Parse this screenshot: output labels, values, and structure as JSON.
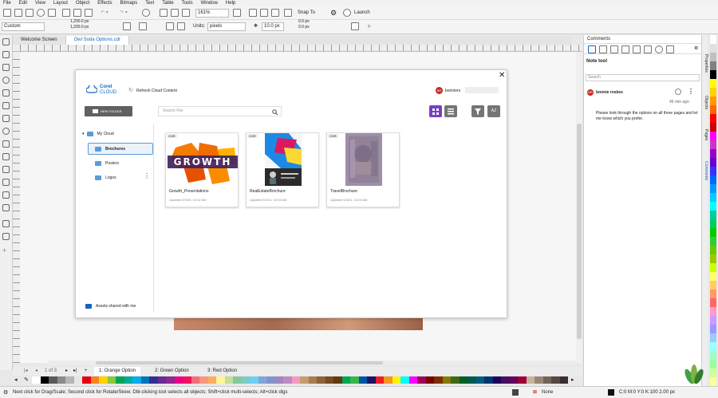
{
  "menu": [
    "File",
    "Edit",
    "View",
    "Layout",
    "Object",
    "Effects",
    "Bitmaps",
    "Text",
    "Table",
    "Tools",
    "Window",
    "Help"
  ],
  "toolbar": {
    "zoom": "161%",
    "snap_label": "Snap To",
    "launch_label": "Launch",
    "preset": "Custom",
    "width": "1,200.0 px",
    "height": "1,200.0 px",
    "units_label": "Units:",
    "units": "pixels",
    "nudge": "10.0 px",
    "dup_x": "0.0 px",
    "dup_y": "0.0 px"
  },
  "doc_tabs": [
    {
      "label": "Welcome Screen"
    },
    {
      "label": "Owl Soda Options.cdr"
    }
  ],
  "dialog": {
    "logo_line1": "Corel",
    "logo_line2": "CLOUD",
    "refresh_label": "Refresh Cloud Content",
    "user_initials": "BR",
    "user_name": "bonniers",
    "new_folder_label": "NEW FOLDER",
    "search_placeholder": "Search File",
    "tree": {
      "root": "My Cloud",
      "folders": [
        "Brochures",
        "Posters",
        "Logos"
      ]
    },
    "assets_shared": "Assets shared with me",
    "files": [
      {
        "badge": "CDR",
        "name": "Growth_Presentations",
        "date": "Updated 9/3/20, 10:02 AM"
      },
      {
        "badge": "CDR",
        "name": "RealEstateBrochure",
        "date": "Updated 9/3/21, 10:03 AM"
      },
      {
        "badge": "CDR",
        "name": "TravelBrochure",
        "date": "Updated 9/3/21, 10:03 AM"
      }
    ],
    "growth_text": "GROWTH"
  },
  "comments": {
    "panel_title": "Comments",
    "tool_title": "Note tool",
    "search_placeholder": "Search",
    "author_initials": "BR",
    "author": "bonnie roskes",
    "time": "46 min ago",
    "text": "Please look through the options on all three pages and let me know which you prefer."
  },
  "side_tabs": [
    "Properties",
    "Objects",
    "Pages",
    "Comments"
  ],
  "pages": {
    "counter": "1 of 3",
    "tabs": [
      "1: Orange Option",
      "2: Green Option",
      "3: Red Option"
    ]
  },
  "status": {
    "hint": "Next click for Drag/Scale; Second click for Rotate/Skew; Dbl-clicking tool selects all objects; Shift+click multi-selects; Alt+click digs",
    "fill": "None",
    "outline": "C:0 M:0 Y:0 K:100  2.00 px"
  },
  "colors": {
    "accent": "#1565c0",
    "view_active": "#7b3fbf",
    "avatar": "#c62828"
  },
  "palette": [
    "#ffffff",
    "#000000",
    "#5a5a5a",
    "#8a8a8a",
    "#b5b5b5",
    "#e6e6e6",
    "#e60012",
    "#f58220",
    "#ffd200",
    "#8dc63f",
    "#00a651",
    "#00a99d",
    "#00aeef",
    "#0072bc",
    "#2e3192",
    "#662d91",
    "#92278f",
    "#ec008c",
    "#ed145b",
    "#f26d7d",
    "#f7977a",
    "#fbaf5d",
    "#fff799",
    "#c4df9b",
    "#82ca9c",
    "#7accc8",
    "#6dcff6",
    "#7da7d9",
    "#8393ca",
    "#a187be",
    "#bd8cbf",
    "#f49ac1",
    "#c69c6d",
    "#a67c52",
    "#8c6239",
    "#754c24",
    "#603913",
    "#00a651",
    "#39b54a",
    "#0054a6",
    "#1b1464",
    "#ed1c24",
    "#f7941d",
    "#fff200",
    "#00ffff",
    "#ff00ff",
    "#9e005d",
    "#790000",
    "#7b2e00",
    "#827b00",
    "#406618",
    "#005e20",
    "#005952",
    "#005b7f",
    "#003471",
    "#21005d",
    "#440e62",
    "#630460",
    "#9e0039",
    "#c7b299",
    "#998675",
    "#736357",
    "#534741",
    "#362f2d"
  ],
  "right_palette": [
    "#ffffff",
    "#e0e0e0",
    "#c0c0c0",
    "#808080",
    "#000000",
    "#ffff00",
    "#ffd200",
    "#ff9900",
    "#ff6600",
    "#ff0000",
    "#cc0000",
    "#ff00ff",
    "#cc33cc",
    "#9900cc",
    "#6600cc",
    "#3333ff",
    "#0066ff",
    "#0099ff",
    "#00ccff",
    "#00ffff",
    "#00cc99",
    "#00cc66",
    "#00cc00",
    "#33cc33",
    "#66cc00",
    "#99cc00",
    "#ccff00",
    "#ffff66",
    "#ffcc66",
    "#ff9966",
    "#ff6666",
    "#ff99cc",
    "#cc99ff",
    "#9999ff",
    "#99ccff",
    "#99ffff",
    "#99ffcc",
    "#99ff99",
    "#ccff99",
    "#ffff99"
  ]
}
